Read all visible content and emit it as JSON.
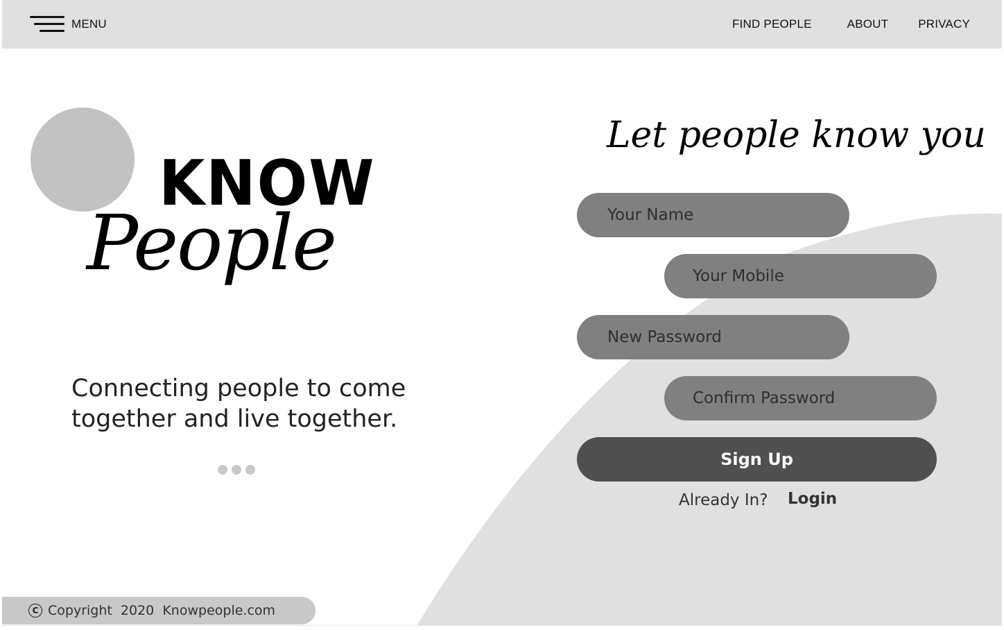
{
  "nav": {
    "menu_label": "MENU",
    "links": [
      {
        "label": "FIND PEOPLE"
      },
      {
        "label": "ABOUT"
      },
      {
        "label": "PRIVACY"
      }
    ]
  },
  "brand": {
    "logo_top": "KNOW",
    "logo_bottom": "People",
    "tagline": "Connecting people to come together and live together.",
    "carousel_dots": 3
  },
  "signup_form": {
    "title": "Let people know you",
    "fields": {
      "name_placeholder": "Your Name",
      "mobile_placeholder": "Your Mobile",
      "password_placeholder": "New Password",
      "confirm_placeholder": "Confirm Password"
    },
    "submit_label": "Sign Up",
    "already_text": "Already In?",
    "login_label": "Login"
  },
  "footer": {
    "text": "Copyright  2020  Knowpeople.com"
  },
  "colors": {
    "topbar": "#e0e0e0",
    "arc": "#e0e0e0",
    "field": "#808080",
    "button": "#505050",
    "footer": "#c8c8c8",
    "logo_circle": "#c2c2c2"
  }
}
